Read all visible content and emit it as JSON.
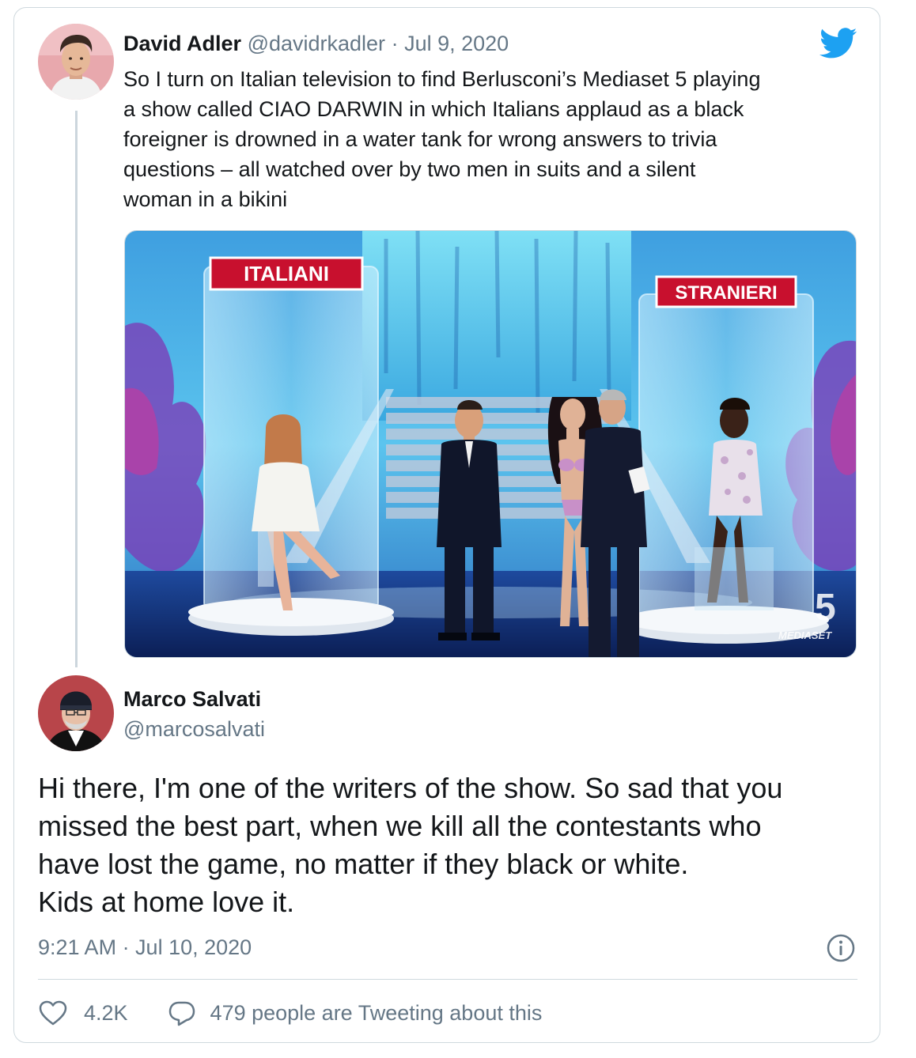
{
  "tweet1": {
    "name": "David Adler",
    "handle": "@davidrkadler",
    "dot": "·",
    "date": "Jul 9, 2020",
    "text": "So I turn on Italian television to find Berlusconi’s Mediaset 5 playing\na show called CIAO DARWIN in which Italians applaud as a black\nforeigner is drowned in a water tank for wrong answers to trivia\nquestions – all watched over by two men in suits and a silent\nwoman in a bikini",
    "media": {
      "sign_left": "ITALIANI",
      "sign_right": "STRANIERI",
      "logo_number": "5",
      "logo_text": "MEDIASET"
    }
  },
  "tweet2": {
    "name": "Marco Salvati",
    "handle": "@marcosalvati",
    "text": "Hi there, I'm one of the writers of the show. So sad that you\nmissed the best part, when we kill all the contestants who\nhave lost the game, no matter if they black or white.\nKids at home love it.",
    "timestamp": "9:21 AM · Jul 10, 2020"
  },
  "actions": {
    "like_count": "4.2K",
    "conversation_text": "479 people are Tweeting about this"
  },
  "colors": {
    "text_primary": "#14171a",
    "text_secondary": "#657786",
    "twitter_blue": "#1da1f2",
    "border": "#cfd9de"
  },
  "icons": [
    "twitter-logo-icon",
    "info-icon",
    "heart-icon",
    "reply-bubble-icon"
  ]
}
